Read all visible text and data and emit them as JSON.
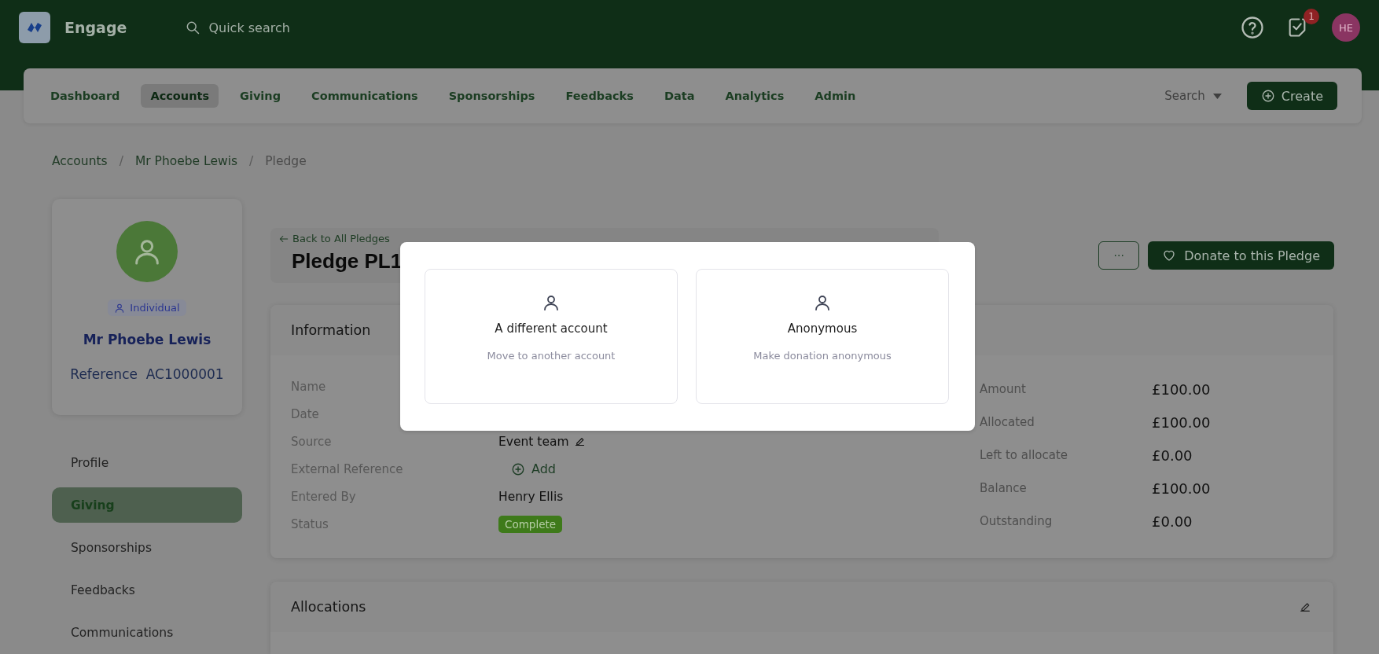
{
  "app": {
    "name": "Engage",
    "search_placeholder": "Quick search",
    "notification_count": "1",
    "user_initials": "HE"
  },
  "nav": {
    "items": [
      {
        "label": "Dashboard",
        "selected": false
      },
      {
        "label": "Accounts",
        "selected": true
      },
      {
        "label": "Giving",
        "selected": false
      },
      {
        "label": "Communications",
        "selected": false
      },
      {
        "label": "Sponsorships",
        "selected": false
      },
      {
        "label": "Feedbacks",
        "selected": false
      },
      {
        "label": "Data",
        "selected": false
      },
      {
        "label": "Analytics",
        "selected": false
      },
      {
        "label": "Admin",
        "selected": false
      }
    ],
    "search_label": "Search",
    "create_label": "Create"
  },
  "breadcrumb": {
    "separator": "/",
    "items": [
      "Accounts",
      "Mr Phoebe Lewis",
      "Pledge"
    ]
  },
  "profile": {
    "type": "Individual",
    "name": "Mr Phoebe Lewis",
    "reference_label": "Reference",
    "reference": "AC1000001"
  },
  "side_menu": [
    {
      "label": "Profile",
      "selected": false
    },
    {
      "label": "Giving",
      "selected": true
    },
    {
      "label": "Sponsorships",
      "selected": false
    },
    {
      "label": "Feedbacks",
      "selected": false
    },
    {
      "label": "Communications",
      "selected": false
    }
  ],
  "pledge": {
    "back_link": "Back to All Pledges",
    "title": "Pledge PL1",
    "more_label": "···",
    "donate_label": "Donate to this Pledge"
  },
  "information": {
    "title": "Information",
    "fields": [
      {
        "label": "Name",
        "kind": "text"
      },
      {
        "label": "Date",
        "kind": "text"
      },
      {
        "label": "Source",
        "kind": "editable",
        "value": "Event team"
      },
      {
        "label": "External Reference",
        "kind": "add",
        "value": "Add"
      },
      {
        "label": "Entered By",
        "kind": "text",
        "value": "Henry Ellis"
      },
      {
        "label": "Status",
        "kind": "badge",
        "value": "Complete"
      }
    ],
    "totals": [
      {
        "label": "Amount",
        "value": "£100.00"
      },
      {
        "label": "Allocated",
        "value": "£100.00"
      },
      {
        "label": "Left to allocate",
        "value": "£0.00"
      },
      {
        "label": "Balance",
        "value": "£100.00"
      },
      {
        "label": "Outstanding",
        "value": "£0.00"
      }
    ]
  },
  "allocations": {
    "title": "Allocations"
  },
  "modal": {
    "options": [
      {
        "title": "A different account",
        "subtitle": "Move to another account"
      },
      {
        "title": "Anonymous",
        "subtitle": "Make donation anonymous"
      }
    ]
  }
}
